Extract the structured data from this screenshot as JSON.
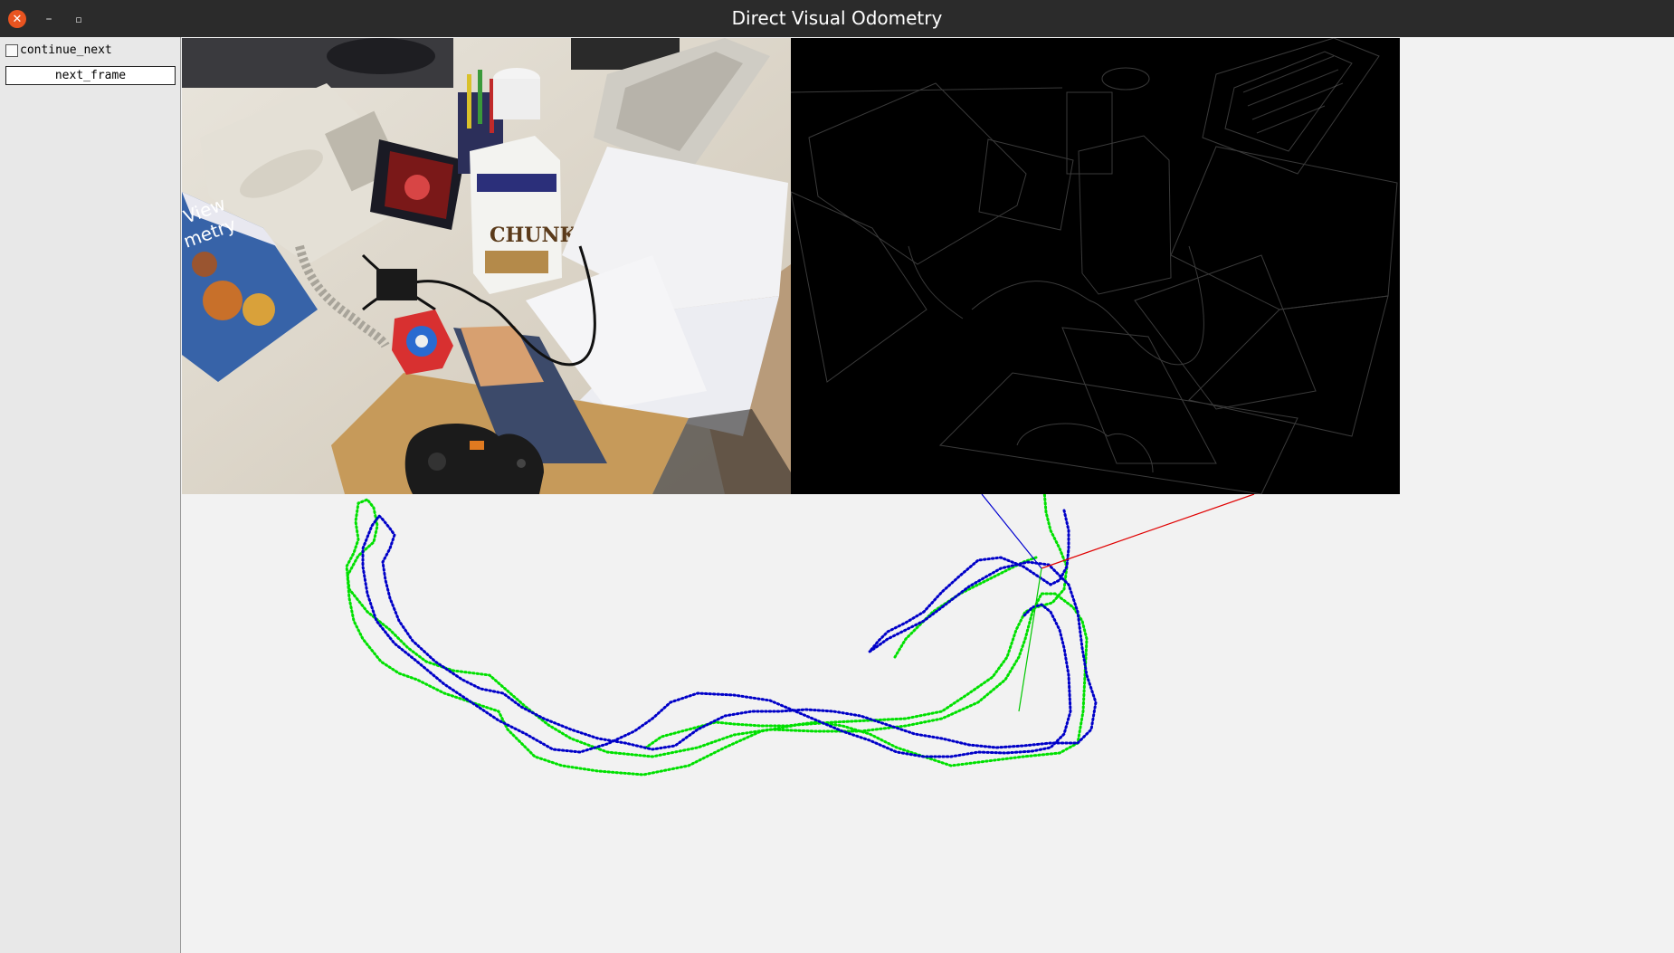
{
  "window": {
    "title": "Direct Visual Odometry",
    "close_glyph": "✕",
    "minimize_glyph": "–",
    "maximize_glyph": "▫"
  },
  "controls": {
    "continue_next_label": "continue_next",
    "continue_next_checked": false,
    "next_frame_label": "next_frame"
  },
  "rgb_image": {
    "book_text": "View\nmetry",
    "milk_text": "CHUNK"
  },
  "trajectory": {
    "ground_truth_color": "#00e000",
    "estimate_color": "#0000c8",
    "axis_x_color": "#e00000",
    "axis_y_color": "#00c800",
    "axis_z_color": "#0000d0"
  }
}
